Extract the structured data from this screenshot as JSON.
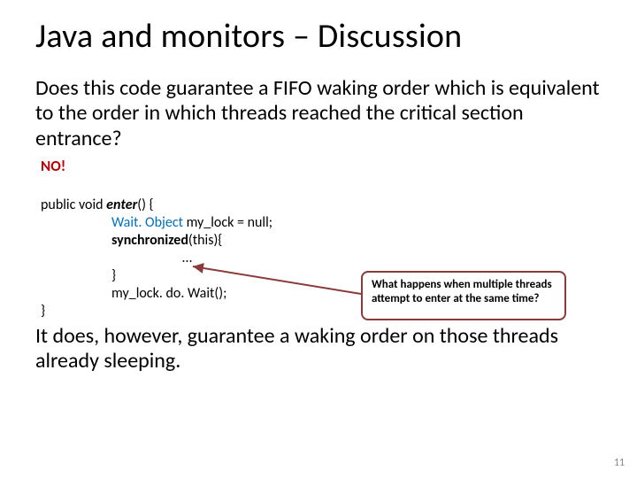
{
  "title": "Java and monitors – Discussion",
  "question": "Does this code guarantee a FIFO waking order which is equivalent to the order in which threads reached the critical section entrance?",
  "no_label": "NO!",
  "code": {
    "l1_pre": "public void ",
    "l1_name": "enter",
    "l1_post": "() {",
    "l2_type": "Wait. Object ",
    "l2_rest": "my_lock = null;",
    "l3_sync": "synchronized",
    "l3_rest": "(this){",
    "l4": "…",
    "l5": "}",
    "l6": "my_lock. do. Wait();",
    "l7": "}"
  },
  "callout": "What happens when multiple threads attempt to enter at the same time?",
  "conclusion": "It does, however, guarantee a waking order on those threads already sleeping.",
  "page_number": "11"
}
